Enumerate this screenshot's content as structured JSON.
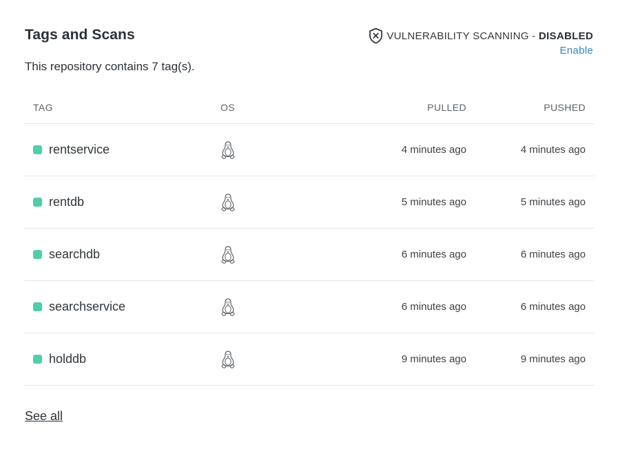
{
  "section": {
    "title": "Tags and Scans",
    "subtitle": "This repository contains 7 tag(s).",
    "see_all": "See all"
  },
  "vulnerability": {
    "label": "VULNERABILITY SCANNING - ",
    "status": "DISABLED",
    "action": "Enable",
    "icon": "shield-x-icon"
  },
  "table": {
    "headers": {
      "tag": "TAG",
      "os": "OS",
      "pulled": "PULLED",
      "pushed": "PUSHED"
    },
    "rows": [
      {
        "tag": "rentservice",
        "os_icon": "linux-icon",
        "pulled": "4 minutes ago",
        "pushed": "4 minutes ago"
      },
      {
        "tag": "rentdb",
        "os_icon": "linux-icon",
        "pulled": "5 minutes ago",
        "pushed": "5 minutes ago"
      },
      {
        "tag": "searchdb",
        "os_icon": "linux-icon",
        "pulled": "6 minutes ago",
        "pushed": "6 minutes ago"
      },
      {
        "tag": "searchservice",
        "os_icon": "linux-icon",
        "pulled": "6 minutes ago",
        "pushed": "6 minutes ago"
      },
      {
        "tag": "holddb",
        "os_icon": "linux-icon",
        "pulled": "9 minutes ago",
        "pushed": "9 minutes ago"
      }
    ]
  },
  "colors": {
    "status_dot": "#4fcfaa",
    "link": "#2f86c8",
    "divider": "#e3e6e9"
  }
}
